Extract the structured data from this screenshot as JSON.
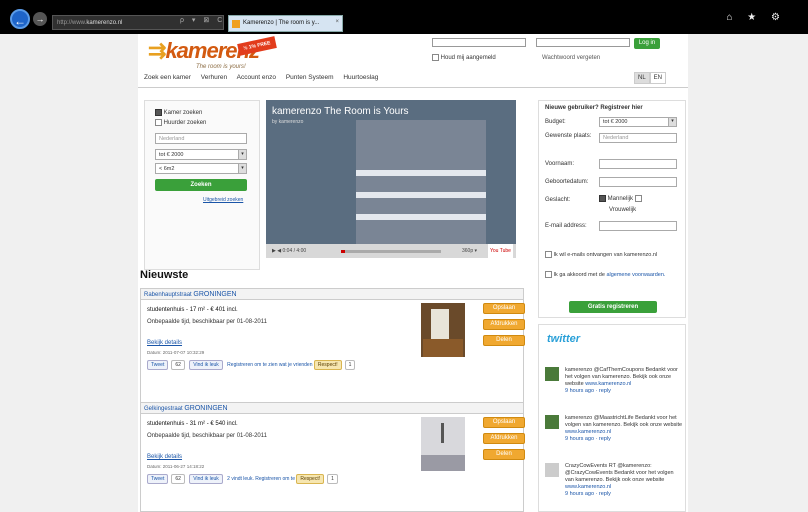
{
  "browser": {
    "url": "http://www.kamerenzo.nl",
    "url_host": "kamerenzo.nl",
    "url_prefix": "http://www.",
    "url_icons": "ρ ▾ ⊠ C ✕",
    "tab_title": "Kamerenzo | The room is y...",
    "tab_close": "×",
    "right_tools": "⌂ ★ ⚙"
  },
  "header": {
    "logo_text": "kamerenz",
    "logo_mark": "⇉",
    "tagline": "The room is yours!",
    "badge": "½ 1% FREE",
    "remember_label": "Houd mij aangemeld",
    "forgot_label": "Wachtwoord vergeten",
    "login_button": "Log in"
  },
  "nav": {
    "items": [
      "Zoek een kamer",
      "Verhuren",
      "Account enzo",
      "Punten Systeem",
      "Huurtoeslag"
    ],
    "langs": [
      "NL",
      "EN"
    ]
  },
  "search": {
    "radio1": "Kamer zoeken",
    "radio2": "Huurder zoeken",
    "country": "Nederland",
    "price": "tot € 2000",
    "size": "< 6m2",
    "button": "Zoeken",
    "advanced": "Uitgebreid zoeken"
  },
  "video": {
    "title": "kamerenzo The Room is Yours",
    "by": "by kamerenzo",
    "time": "0:04 / 4:00",
    "quality": "360p ▾",
    "brand": "You Tube"
  },
  "nieuwste": "Nieuwste",
  "listings": [
    {
      "street": "Rabenhauptstraat",
      "city": "GRONINGEN",
      "title": "studentenhuis - 17 m² - € 401 incl.",
      "sub": "Onbepaalde tijd, beschikbaar per 01-08-2011",
      "details": "Bekijk details",
      "date": "Datum: 2011-07-07 10:32:29",
      "tweet": "Tweet",
      "tweet_count": "62",
      "like": "Vind ik leuk",
      "fb_text": "Registreren om te zien wat je vrienden",
      "respect": "Respect!",
      "respect_count": "1",
      "btn_save": "Opslaan",
      "btn_print": "Afdrukken",
      "btn_share": "Delen"
    },
    {
      "street": "Gelkingestraat",
      "city": "GRONINGEN",
      "title": "studentenhuis - 31 m² - € 540 incl.",
      "sub": "Onbepaalde tijd, beschikbaar per 01-08-2011",
      "details": "Bekijk details",
      "date": "Datum: 2011-06-27 14:18:22",
      "tweet": "Tweet",
      "tweet_count": "62",
      "like": "Vind ik leuk",
      "fb_text": "2 vindt leuk. Registreren om te",
      "respect": "Respect!",
      "respect_count": "1",
      "btn_save": "Opslaan",
      "btn_print": "Afdrukken",
      "btn_share": "Delen"
    }
  ],
  "register": {
    "heading": "Nieuwe gebruiker? Registreer hier",
    "budget_label": "Budget:",
    "budget_value": "tot € 2000",
    "city_label": "Gewenste plaats:",
    "city_value": "Nederland",
    "first_label": "Voornaam:",
    "birth_label": "Geboortedatum:",
    "gender_label": "Geslacht:",
    "male": "Mannelijk",
    "female": "Vrouwelijk",
    "email_label": "E-mail address:",
    "optin": "Ik wil e-mails ontvangen van kamerenzo.nl",
    "terms": "Ik ga akkoord met de",
    "terms_link": "algemene voorwaarden.",
    "button": "Gratis registreren"
  },
  "twitter": {
    "logo": "twitter",
    "items": [
      {
        "text": "kamerenzo @CafThemCoupons Bedankt voor het volgen van kamerenzo. Bekijk ook onze website",
        "link": "www.kamerenzo.nl",
        "meta": "9 hours ago · reply"
      },
      {
        "text": "kamerenzo @MaastrichtLife Bedankt voor het volgen van kamerenzo. Bekijk ook onze website",
        "link": "www.kamerenzo.nl",
        "meta": "9 hours ago · reply"
      },
      {
        "text": "CrazyCowEvents RT @kamerenzo: @CrazyCowEvents Bedankt voor het volgen van kamerenzo. Bekijk ook onze website",
        "link": "www.kamerenzo.nl",
        "meta": "9 hours ago · reply"
      }
    ]
  },
  "colors": {
    "accent_green": "#3aa03a",
    "accent_orange": "#f0a830",
    "logo_orange": "#d35a10",
    "link_blue": "#1a55a8"
  }
}
